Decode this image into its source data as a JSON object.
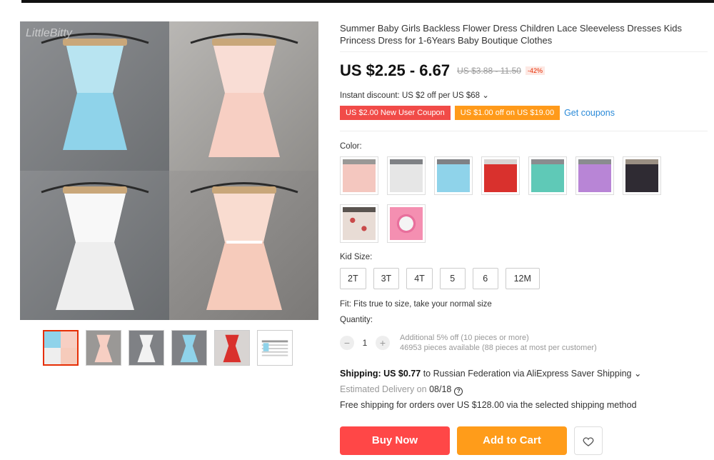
{
  "gallery": {
    "watermark": "LittleBitty",
    "thumbnails": [
      "collage",
      "pink-dress",
      "white-dress",
      "blue-dress",
      "red-dress",
      "size-chart"
    ]
  },
  "product": {
    "title": "Summer Baby Girls Backless Flower Dress Children Lace Sleeveless Dresses Kids Princess Dress for 1-6Years Baby Boutique Clothes",
    "price": "US $2.25 - 6.67",
    "old_price": "US $3.88 - 11.50",
    "discount": "-42%",
    "instant_discount": "Instant discount: US $2 off per US $68 ⌄",
    "coupon_new_user": "US $2.00 New User Coupon",
    "coupon_off": "US $1.00 off on US $19.00",
    "get_coupons": "Get coupons"
  },
  "color": {
    "label": "Color:",
    "swatches": [
      {
        "name": "pink",
        "color": "#f4c7bf"
      },
      {
        "name": "white",
        "color": "#e6e6e6"
      },
      {
        "name": "blue",
        "color": "#8fd3ea"
      },
      {
        "name": "red",
        "color": "#d9312d"
      },
      {
        "name": "teal",
        "color": "#5fc9b7"
      },
      {
        "name": "purple",
        "color": "#b885d6"
      },
      {
        "name": "black",
        "color": "#2f2b33"
      },
      {
        "name": "floral",
        "color": "#e8dcd5"
      },
      {
        "name": "headband",
        "color": "#f48fb1"
      }
    ]
  },
  "size": {
    "label": "Kid Size:",
    "options": [
      "2T",
      "3T",
      "4T",
      "5",
      "6",
      "12M"
    ]
  },
  "fit": "Fit: Fits true to size, take your normal size",
  "quantity": {
    "label": "Quantity:",
    "value": "1",
    "minus": "−",
    "plus": "+",
    "additional": "Additional 5% off (10 pieces or more)",
    "available": "46953 pieces available (88 pieces at most per customer)"
  },
  "shipping": {
    "label": "Shipping: US $0.77",
    "destination": " to Russian Federation via AliExpress Saver Shipping ⌄",
    "delivery_label": "Estimated Delivery on ",
    "delivery_date": "08/18",
    "help": "?",
    "free": "Free shipping for orders over US $128.00 via the selected shipping method"
  },
  "actions": {
    "buy_now": "Buy Now",
    "add_to_cart": "Add to Cart",
    "wishlist_icon": "heart-icon"
  }
}
